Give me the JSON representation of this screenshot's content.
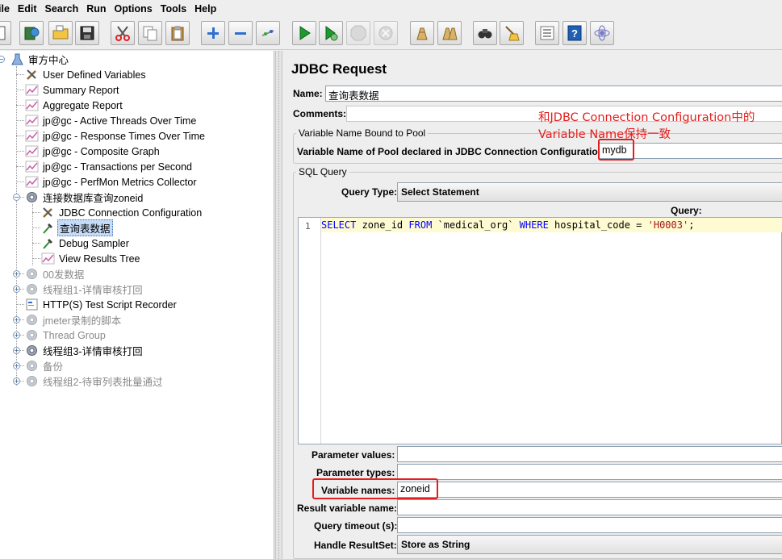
{
  "menu": [
    "ile",
    "Edit",
    "Search",
    "Run",
    "Options",
    "Tools",
    "Help"
  ],
  "toolbar_icons": [
    "new-icon",
    "templates-icon",
    "open-icon",
    "save-icon",
    "cut-icon",
    "copy-icon",
    "paste-icon",
    "expand-icon",
    "collapse-icon",
    "toggle-icon",
    "start-icon",
    "start-no-pause-icon",
    "stop-icon",
    "shutdown-icon",
    "clear-icon",
    "clear-all-icon",
    "search-icon",
    "reset-search-icon",
    "function-helper-icon",
    "help-icon",
    "remote-icon"
  ],
  "tree": [
    {
      "label": "审方中心",
      "icon": "test-plan-icon",
      "disabled": false,
      "selected": false
    },
    {
      "label": "User Defined Variables",
      "icon": "wrench-icon",
      "disabled": false,
      "selected": false
    },
    {
      "label": "Summary Report",
      "icon": "graph-icon",
      "disabled": false,
      "selected": false
    },
    {
      "label": "Aggregate Report",
      "icon": "graph-icon",
      "disabled": false,
      "selected": false
    },
    {
      "label": "jp@gc - Active Threads Over Time",
      "icon": "graph-icon",
      "disabled": false,
      "selected": false
    },
    {
      "label": "jp@gc - Response Times Over Time",
      "icon": "graph-icon",
      "disabled": false,
      "selected": false
    },
    {
      "label": "jp@gc - Composite Graph",
      "icon": "graph-icon",
      "disabled": false,
      "selected": false
    },
    {
      "label": "jp@gc - Transactions per Second",
      "icon": "graph-icon",
      "disabled": false,
      "selected": false
    },
    {
      "label": "jp@gc - PerfMon Metrics Collector",
      "icon": "graph-icon",
      "disabled": false,
      "selected": false
    },
    {
      "label": "连接数据库查询zoneid",
      "icon": "gear-icon",
      "disabled": false,
      "selected": false
    },
    {
      "label": "JDBC Connection Configuration",
      "icon": "wrench-icon",
      "disabled": false,
      "selected": false
    },
    {
      "label": "查询表数据",
      "icon": "pipette-icon",
      "disabled": false,
      "selected": true
    },
    {
      "label": "Debug Sampler",
      "icon": "pipette-icon",
      "disabled": false,
      "selected": false
    },
    {
      "label": "View Results Tree",
      "icon": "graph-icon",
      "disabled": false,
      "selected": false
    },
    {
      "label": "00发数据",
      "icon": "gear-icon",
      "disabled": true,
      "selected": false
    },
    {
      "label": "线程组1-详情审核打回",
      "icon": "gear-icon",
      "disabled": true,
      "selected": false
    },
    {
      "label": "HTTP(S) Test Script Recorder",
      "icon": "recorder-icon",
      "disabled": false,
      "selected": false
    },
    {
      "label": "jmeter录制的脚本",
      "icon": "gear-icon",
      "disabled": true,
      "selected": false
    },
    {
      "label": "Thread Group",
      "icon": "gear-icon",
      "disabled": true,
      "selected": false
    },
    {
      "label": "线程组3-详情审核打回",
      "icon": "gear-icon",
      "disabled": false,
      "selected": false
    },
    {
      "label": "备份",
      "icon": "gear-icon",
      "disabled": true,
      "selected": false
    },
    {
      "label": "线程组2-待审列表批量通过",
      "icon": "gear-icon",
      "disabled": true,
      "selected": false
    }
  ],
  "form": {
    "title": "JDBC Request",
    "name_label": "Name:",
    "name_value": "查询表数据",
    "comments_label": "Comments:",
    "pool_group_title": "Variable Name Bound to Pool",
    "pool_label": "Variable Name of Pool declared in JDBC Connection Configuration:",
    "pool_value": "mydb",
    "sql_group_title": "SQL Query",
    "query_type_label": "Query Type:",
    "query_type_value": "Select Statement",
    "query_label": "Query:",
    "query_line_number": "1",
    "param_values_label": "Parameter values:",
    "param_types_label": "Parameter types:",
    "var_names_label": "Variable names:",
    "var_names_value": "zoneid",
    "result_var_label": "Result variable name:",
    "timeout_label": "Query timeout (s):",
    "handle_label": "Handle ResultSet:",
    "handle_value": "Store as String"
  },
  "sql_tokens": [
    {
      "text": "SELECT",
      "kind": "kw"
    },
    {
      "text": " zone_id ",
      "kind": "plain"
    },
    {
      "text": "FROM",
      "kind": "kw"
    },
    {
      "text": " `medical_org` ",
      "kind": "plain"
    },
    {
      "text": "WHERE",
      "kind": "kw"
    },
    {
      "text": " hospital_code = ",
      "kind": "plain"
    },
    {
      "text": "'H0003'",
      "kind": "str"
    },
    {
      "text": ";",
      "kind": "plain"
    }
  ],
  "annotation": {
    "line1": "和JDBC Connection Configuration中的",
    "line2": "Variable Name保持一致",
    "color": "#e21e1e"
  },
  "colors": {
    "selection": "#c6dbf5",
    "editor_line_bg": "#fefbd2",
    "keyword": "#0000ff",
    "string": "#a31515"
  }
}
